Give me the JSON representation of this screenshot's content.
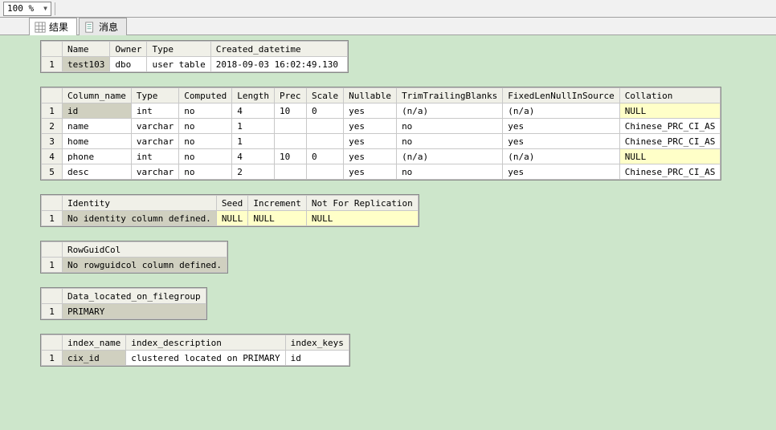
{
  "toolbar": {
    "zoom": "100 %"
  },
  "tabs": {
    "results": "结果",
    "messages": "消息"
  },
  "table_meta": {
    "headers": {
      "name": "Name",
      "owner": "Owner",
      "type": "Type",
      "created": "Created_datetime"
    },
    "row": {
      "name": "test103",
      "owner": "dbo",
      "type": "user table",
      "created": "2018-09-03 16:02:49.130"
    }
  },
  "columns": {
    "headers": {
      "name": "Column_name",
      "type": "Type",
      "computed": "Computed",
      "length": "Length",
      "prec": "Prec",
      "scale": "Scale",
      "nullable": "Nullable",
      "trim": "TrimTrailingBlanks",
      "fixed": "FixedLenNullInSource",
      "collation": "Collation"
    },
    "rows": [
      {
        "n": "1",
        "name": "id",
        "type": "int",
        "computed": "no",
        "length": "4",
        "prec": "10",
        "scale": "0",
        "nullable": "yes",
        "trim": "(n/a)",
        "fixed": "(n/a)",
        "collation": "NULL",
        "coll_yellow": true,
        "sel": true
      },
      {
        "n": "2",
        "name": "name",
        "type": "varchar",
        "computed": "no",
        "length": "1",
        "prec": "",
        "scale": "",
        "nullable": "yes",
        "trim": "no",
        "fixed": "yes",
        "collation": "Chinese_PRC_CI_AS",
        "coll_yellow": false,
        "sel": false
      },
      {
        "n": "3",
        "name": "home",
        "type": "varchar",
        "computed": "no",
        "length": "1",
        "prec": "",
        "scale": "",
        "nullable": "yes",
        "trim": "no",
        "fixed": "yes",
        "collation": "Chinese_PRC_CI_AS",
        "coll_yellow": false,
        "sel": false
      },
      {
        "n": "4",
        "name": "phone",
        "type": "int",
        "computed": "no",
        "length": "4",
        "prec": "10",
        "scale": "0",
        "nullable": "yes",
        "trim": "(n/a)",
        "fixed": "(n/a)",
        "collation": "NULL",
        "coll_yellow": true,
        "sel": false
      },
      {
        "n": "5",
        "name": "desc",
        "type": "varchar",
        "computed": "no",
        "length": "2",
        "prec": "",
        "scale": "",
        "nullable": "yes",
        "trim": "no",
        "fixed": "yes",
        "collation": "Chinese_PRC_CI_AS",
        "coll_yellow": false,
        "sel": false
      }
    ]
  },
  "identity": {
    "headers": {
      "identity": "Identity",
      "seed": "Seed",
      "increment": "Increment",
      "nfr": "Not For Replication"
    },
    "row": {
      "identity": "No identity column defined.",
      "seed": "NULL",
      "increment": "NULL",
      "nfr": "NULL"
    }
  },
  "rowguid": {
    "header": "RowGuidCol",
    "value": "No rowguidcol column defined."
  },
  "filegroup": {
    "header": "Data_located_on_filegroup",
    "value": "PRIMARY"
  },
  "index": {
    "headers": {
      "name": "index_name",
      "desc": "index_description",
      "keys": "index_keys"
    },
    "row": {
      "name": "cix_id",
      "desc": "clustered located on PRIMARY",
      "keys": "id"
    }
  }
}
